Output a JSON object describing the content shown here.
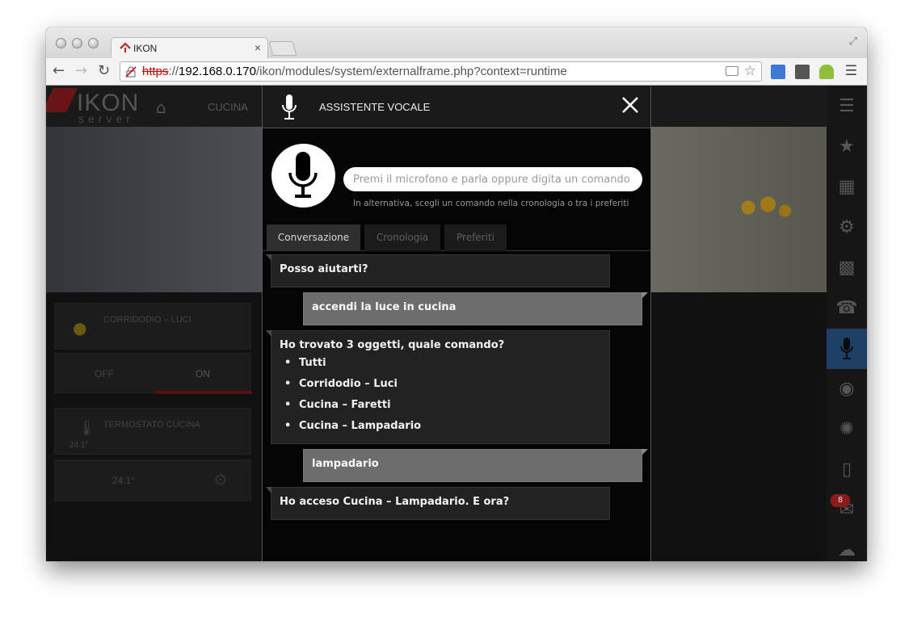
{
  "browser": {
    "tab_title": "IKON",
    "tab_close": "×",
    "url_scheme": "https",
    "url_sep": "://",
    "url_host": "192.168.0.170",
    "url_path": "/ikon/modules/system/externalframe.php?context=runtime"
  },
  "app": {
    "brand_name": "IKON",
    "brand_sub": "server",
    "room_label": "CUCINA",
    "widgets": {
      "corridoio_title": "CORRIDODIO – LUCI",
      "off_label": "OFF",
      "on_label": "ON",
      "thermostat_title": "TERMOSTATO CUCINA",
      "thermostat_small": "24.1°",
      "thermostat_value": "24.1°"
    },
    "notification_count": "8",
    "accent_color": "#1e3f66"
  },
  "dialog": {
    "title": "ASSISTENTE VOCALE",
    "input_placeholder": "Premi il microfono e parla oppure digita un comando",
    "input_value": "",
    "hint": "In alternativa, scegli un comando nella cronologia o tra i preferiti",
    "tabs": [
      {
        "label": "Conversazione",
        "active": true
      },
      {
        "label": "Cronologia",
        "active": false
      },
      {
        "label": "Preferiti",
        "active": false
      }
    ],
    "messages": [
      {
        "from": "bot",
        "text": "Posso aiutarti?"
      },
      {
        "from": "user",
        "text": "accendi la luce in cucina"
      },
      {
        "from": "bot",
        "text": "Ho trovato 3 oggetti, quale comando?",
        "options": [
          "Tutti",
          "Corridodio – Luci",
          "Cucina – Faretti",
          "Cucina – Lampadario"
        ]
      },
      {
        "from": "user",
        "text": "lampadario"
      },
      {
        "from": "bot",
        "text": "Ho acceso Cucina – Lampadario. E ora?"
      }
    ]
  }
}
